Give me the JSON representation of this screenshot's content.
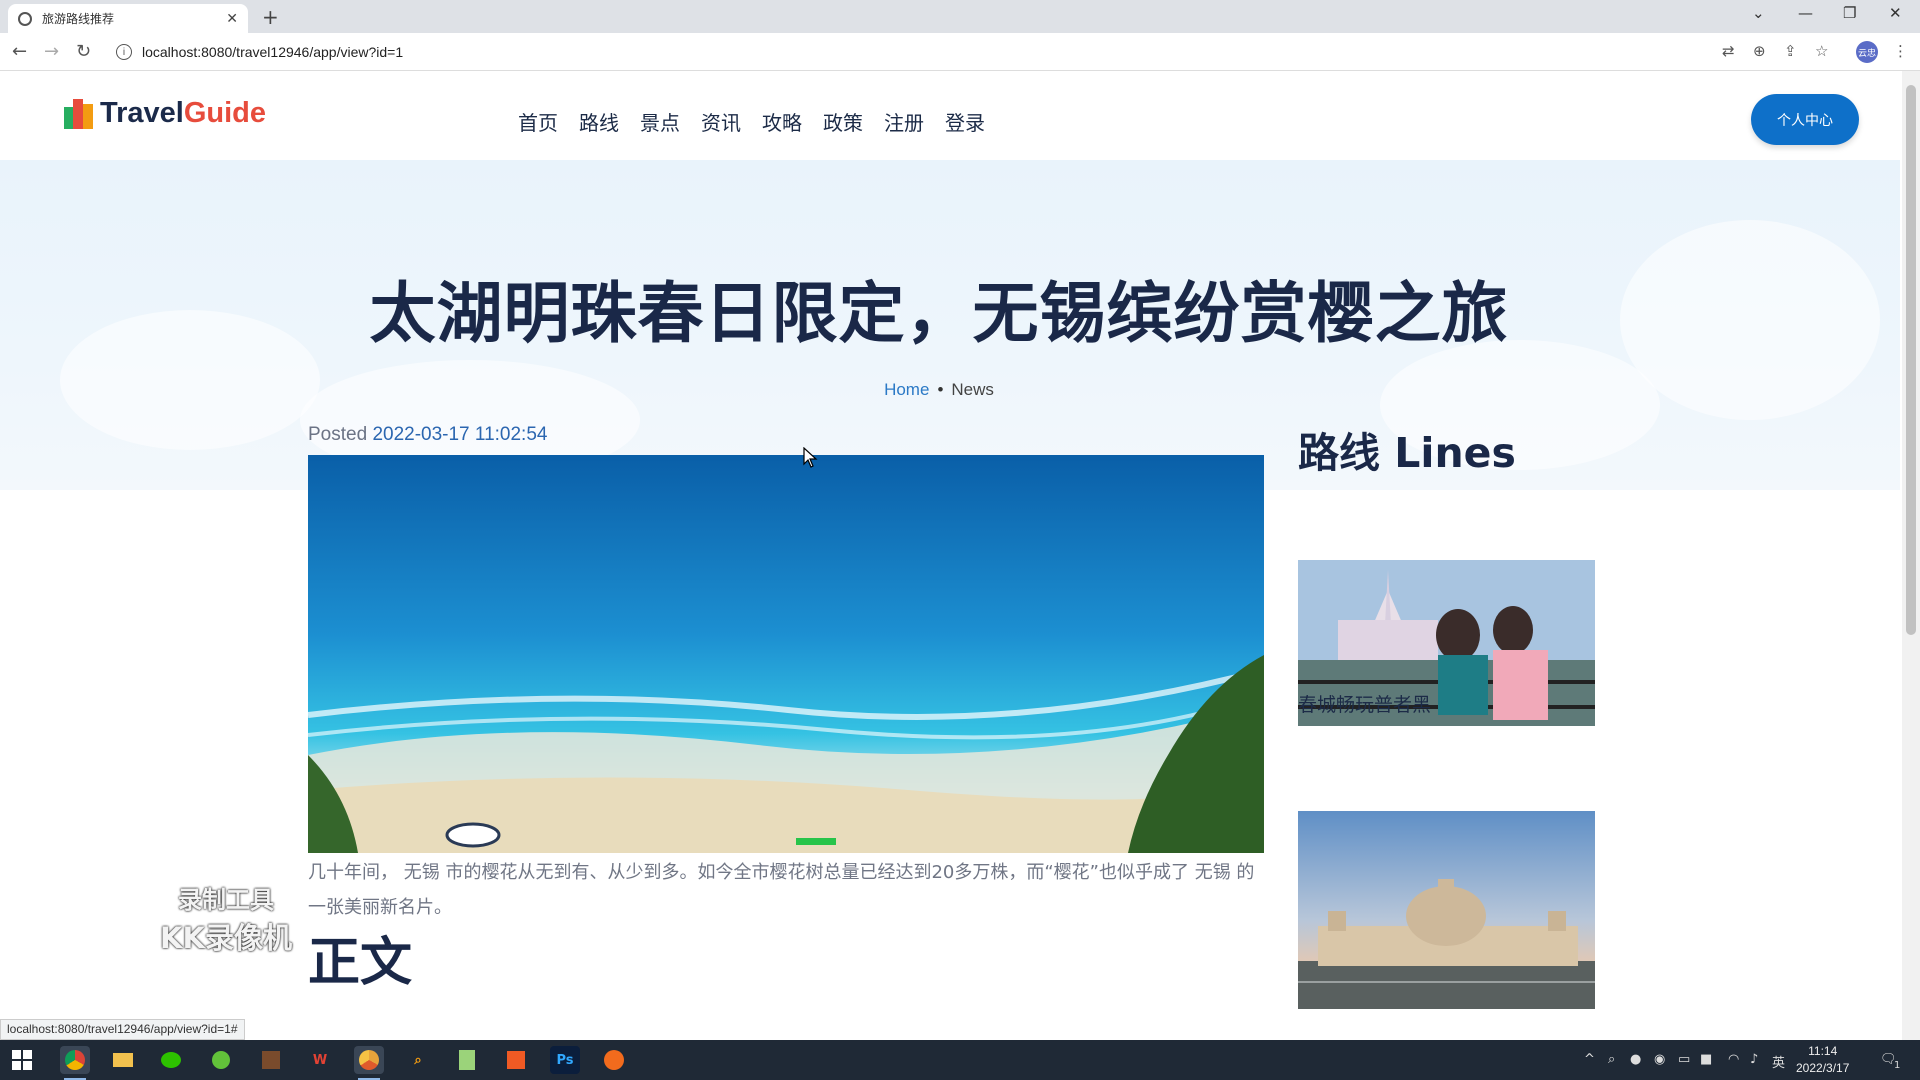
{
  "browser": {
    "tab_title": "旅游路线推荐",
    "url": "localhost:8080/travel12946/app/view?id=1",
    "status_url": "localhost:8080/travel12946/app/view?id=1#",
    "profile_label": "云忠"
  },
  "header": {
    "logo_part1": "Travel",
    "logo_part2": "Guide",
    "nav": [
      "首页",
      "路线",
      "景点",
      "资讯",
      "攻略",
      "政策",
      "注册",
      "登录"
    ],
    "user_center": "个人中心"
  },
  "hero": {
    "title": "太湖明珠春日限定，无锡缤纷赏樱之旅",
    "breadcrumb_home": "Home",
    "breadcrumb_sep": "•",
    "breadcrumb_current": "News"
  },
  "article": {
    "posted_label": "Posted",
    "posted_date": "2022-03-17 11:02:54",
    "body": "几十年间， 无锡 市的樱花从无到有、从少到多。如今全市樱花树总量已经达到20多万株，而“樱花”也似乎成了 无锡 的一张美丽新名片。",
    "section_heading": "正文"
  },
  "sidebar": {
    "title": "路线 Lines",
    "items": [
      {
        "caption": "春城畅玩普者黑"
      }
    ]
  },
  "watermark": {
    "line1": "录制工具",
    "line2": "KK录像机"
  },
  "taskbar": {
    "time": "11:14",
    "date": "2022/3/17",
    "ime": "英",
    "notifications": "1"
  },
  "colors": {
    "accent": "#0e70c9",
    "logo_red": "#e74c3c",
    "heading": "#1a2848"
  }
}
